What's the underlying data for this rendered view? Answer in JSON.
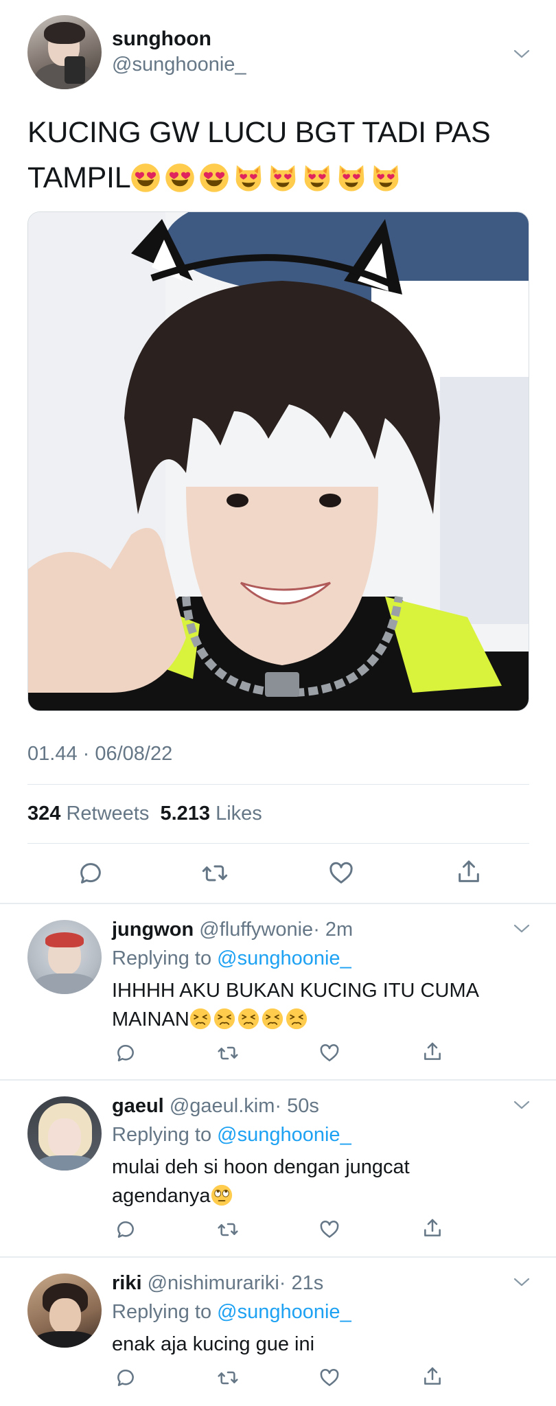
{
  "tweet": {
    "author": {
      "name": "sunghoon",
      "handle": "@sunghoonie_"
    },
    "text": "KUCING GW LUCU BGT TADI PAS TAMPIL",
    "emojis": [
      "heart-eyes-emoji",
      "heart-eyes-emoji",
      "heart-eyes-emoji",
      "heart-eyes-cat-emoji",
      "heart-eyes-cat-emoji",
      "heart-eyes-cat-emoji",
      "heart-eyes-cat-emoji",
      "heart-eyes-cat-emoji"
    ],
    "timestamp": "01.44 · 06/08/22",
    "retweet_count": "324",
    "retweet_label": "Retweets",
    "like_count": "5.213",
    "like_label": "Likes",
    "actions": [
      "reply-icon",
      "retweet-icon",
      "like-icon",
      "share-icon"
    ]
  },
  "replies": [
    {
      "name": "jungwon",
      "handle": "@fluffywonie",
      "time": "· 2m",
      "replying_prefix": "Replying to",
      "replying_to": "@sunghoonie_",
      "text_line1": "IHHHH AKU BUKAN KUCING ITU CUMA",
      "text_line2": "MAINAN",
      "emojis": [
        "persevering-face-emoji",
        "persevering-face-emoji",
        "persevering-face-emoji",
        "persevering-face-emoji",
        "persevering-face-emoji"
      ]
    },
    {
      "name": "gaeul",
      "handle": "@gaeul.kim",
      "time": "· 50s",
      "replying_prefix": "Replying to",
      "replying_to": "@sunghoonie_",
      "text_line1": "mulai deh si hoon dengan jungcat",
      "text_line2": "agendanya",
      "emojis": [
        "eye-roll-emoji"
      ]
    },
    {
      "name": "riki",
      "handle": "@nishimurariki",
      "time": "· 21s",
      "replying_prefix": "Replying to",
      "replying_to": "@sunghoonie_",
      "text_line1": "enak aja kucing gue ini",
      "text_line2": "",
      "emojis": []
    }
  ],
  "colors": {
    "text": "#14171a",
    "secondary": "#657786",
    "link": "#1da1f2",
    "divider": "#e1e8ed"
  }
}
